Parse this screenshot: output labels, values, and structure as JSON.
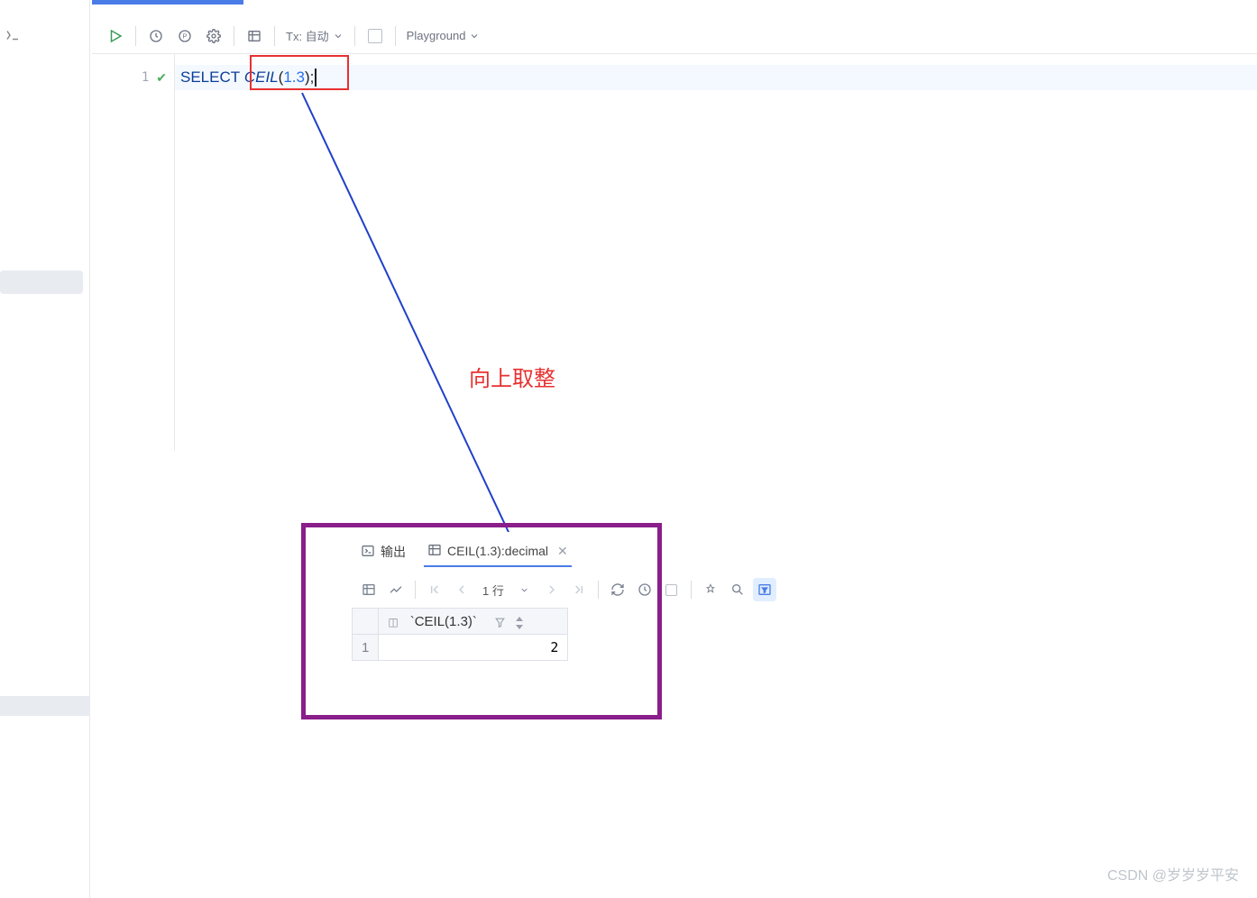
{
  "toolbar": {
    "tx_label": "Tx: 自动",
    "playground_label": "Playground"
  },
  "editor": {
    "line_number": "1",
    "sql": {
      "select": "SELECT",
      "func": "CEIL",
      "open": "(",
      "arg": "1.3",
      "close": ")",
      "semi": ";"
    }
  },
  "annotation": {
    "text": "向上取整"
  },
  "result_panel": {
    "tabs": {
      "output": "输出",
      "result_tab": "CEIL(1.3):decimal"
    },
    "pager": "1 行",
    "header_col": "`CEIL(1.3)`",
    "row_num": "1",
    "value": "2"
  },
  "watermark": "CSDN @岁岁岁平安"
}
